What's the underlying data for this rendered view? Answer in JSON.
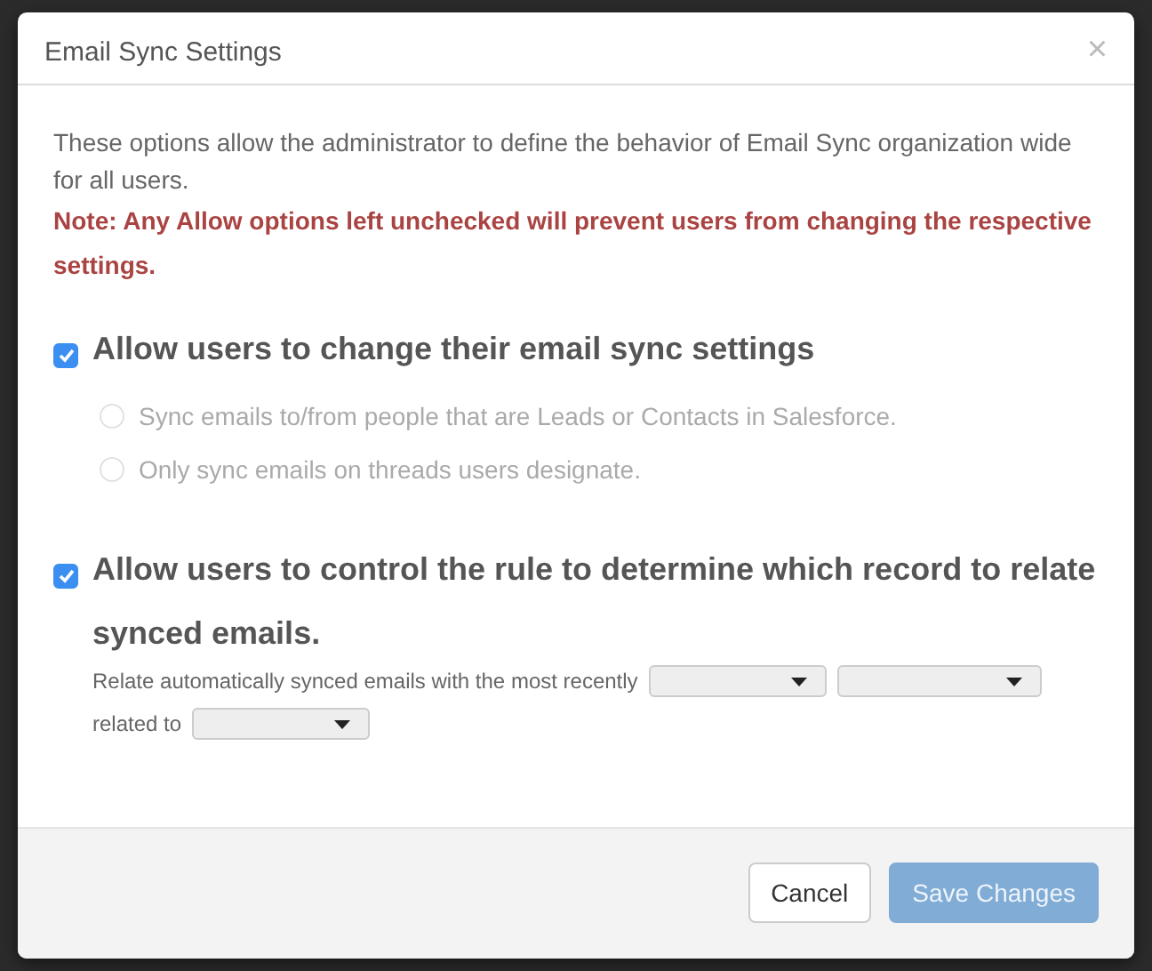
{
  "dialog": {
    "title": "Email Sync Settings",
    "close": "×"
  },
  "intro": "These options allow the administrator to define the behavior of Email Sync organization wide for all users.",
  "note": "Note: Any Allow options left unchecked will prevent users from changing the respective settings.",
  "options": [
    {
      "label": "Allow users to change their email sync settings",
      "checked": true,
      "radios": [
        {
          "label": "Sync emails to/from people that are Leads or Contacts in Salesforce.",
          "selected": false,
          "disabled": true
        },
        {
          "label": "Only sync emails on threads users designate.",
          "selected": false,
          "disabled": true
        }
      ]
    },
    {
      "label": "Allow users to control the rule to determine which record to relate synced emails.",
      "checked": true,
      "rule": {
        "text": "Relate automatically synced emails with the most recently",
        "related_label": "related to"
      }
    }
  ],
  "buttons": [
    {
      "label": "Cancel",
      "kind": "secondary",
      "disabled": false
    },
    {
      "label": "Save Changes",
      "kind": "primary",
      "disabled": true
    }
  ]
}
